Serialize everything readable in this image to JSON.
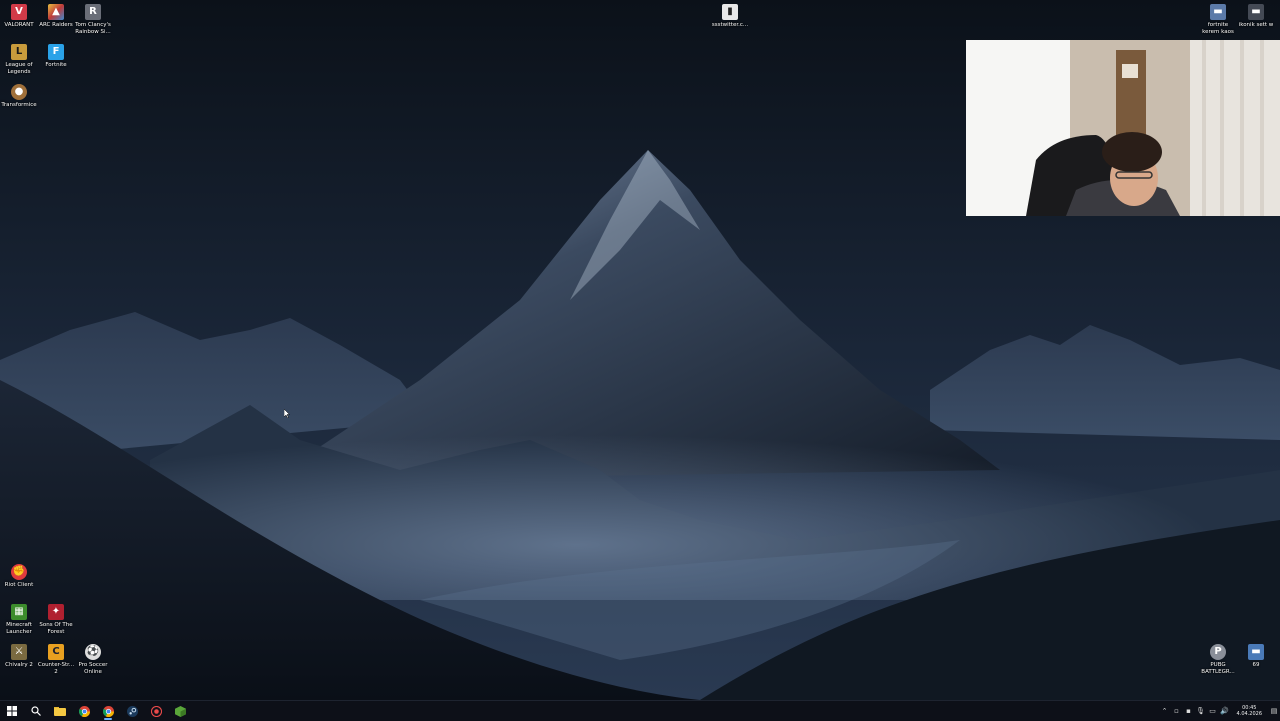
{
  "desktop": {
    "icons_top_left": [
      {
        "label": "VALORANT",
        "icon": "valorant-icon",
        "color": "#d13a48"
      },
      {
        "label": "ARC Raiders",
        "icon": "arc-raiders-icon",
        "color": "#e0b040"
      },
      {
        "label": "Tom Clancy's Rainbow Si...",
        "icon": "rainbow-six-icon",
        "color": "#6a6e78"
      },
      {
        "label": "League of Legends",
        "icon": "league-of-legends-icon",
        "color": "#c89b3c"
      },
      {
        "label": "Fortnite",
        "icon": "fortnite-icon",
        "color": "#2aa2e8"
      },
      {
        "label": "Transformice",
        "icon": "transformice-icon",
        "color": "#a0703a"
      }
    ],
    "icon_top_center": {
      "label": "ssstwitter.c...",
      "icon": "document-icon",
      "color": "#e8e8e8"
    },
    "icons_top_right": [
      {
        "label": "fortnite kerem kaos",
        "icon": "image-file-icon",
        "color": "#5b7aa8"
      },
      {
        "label": "ikonik sett w",
        "icon": "image-file-icon",
        "color": "#444a55"
      }
    ],
    "icons_bottom_left": [
      {
        "label": "Riot Client",
        "icon": "riot-client-icon",
        "color": "#e03a3e"
      },
      {
        "label": "Minecraft Launcher",
        "icon": "minecraft-icon",
        "color": "#3c8c2c"
      },
      {
        "label": "Sons Of The Forest",
        "icon": "sons-of-the-forest-icon",
        "color": "#b02030"
      },
      {
        "label": "Chivalry 2",
        "icon": "chivalry-icon",
        "color": "#7a6a40"
      },
      {
        "label": "Counter-Str... 2",
        "icon": "counter-strike-icon",
        "color": "#e8a020"
      },
      {
        "label": "Pro Soccer Online",
        "icon": "soccer-ball-icon",
        "color": "#dddddd"
      }
    ],
    "icons_bottom_right": [
      {
        "label": "PUBG BATTLEGR...",
        "icon": "pubg-icon",
        "color": "#8a8f99"
      },
      {
        "label": "69",
        "icon": "image-file-icon",
        "color": "#4a7ab8"
      }
    ]
  },
  "taskbar": {
    "buttons": [
      {
        "icon": "windows-start-icon",
        "active": false
      },
      {
        "icon": "search-icon",
        "active": false
      },
      {
        "icon": "file-explorer-icon",
        "active": false
      },
      {
        "icon": "chrome-icon",
        "active": false
      },
      {
        "icon": "chrome-icon",
        "active": true
      },
      {
        "icon": "steam-icon",
        "active": false
      },
      {
        "icon": "record-icon",
        "active": false
      },
      {
        "icon": "minecraft-icon",
        "active": false
      }
    ],
    "clock": {
      "time": "00:45",
      "date": "4.04.2026"
    }
  }
}
